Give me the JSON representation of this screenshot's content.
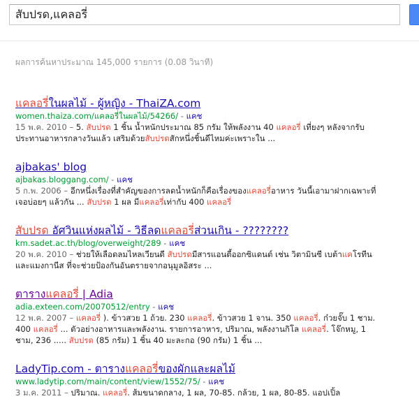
{
  "search": {
    "query": "สับปรด,แคลอรี่"
  },
  "stats": "ผลการค้นหาประมาณ 145,000 รายการ (0.08 วินาที)",
  "cache_label": "แคช",
  "results": [
    {
      "visited": false,
      "title": [
        {
          "t": "แคลอรี่",
          "hl": true
        },
        {
          "t": "ในผลไม้ - ผู้หญิง - ThaiZA.com",
          "hl": false
        }
      ],
      "url": [
        {
          "t": "women.thaiza.com/",
          "hl": false
        },
        {
          "t": "แคลอรี่",
          "hl": true
        },
        {
          "t": "ในผลไม้/54266/",
          "hl": false
        }
      ],
      "snippet": [
        {
          "t": "15 พ.ค. 2010 – ",
          "c": "date"
        },
        {
          "t": "5. ",
          "c": ""
        },
        {
          "t": "สับปรด",
          "c": "hl"
        },
        {
          "t": " 1 ชิ้น น้ำหนักประมาณ 85 กรัม ให้พลังงาน 40 ",
          "c": ""
        },
        {
          "t": "แคลอรี่",
          "c": "hl"
        },
        {
          "t": " เที่ยงๆ หลังจากรับประทานอาหารกลางวันแล้ว เสริมด้วย",
          "c": ""
        },
        {
          "t": "สับปรด",
          "c": "hl"
        },
        {
          "t": "สักหนึ่งชิ้นดีไหมค่ะเพราะใน ...",
          "c": ""
        }
      ]
    },
    {
      "visited": false,
      "title": [
        {
          "t": "ajbakas' blog",
          "hl": false
        }
      ],
      "url": [
        {
          "t": "ajbakas.bloggang.com/",
          "hl": false
        }
      ],
      "snippet": [
        {
          "t": "5 ก.พ. 2006 – ",
          "c": "date"
        },
        {
          "t": "อีกหนึ่งเรื่องที่สำคัญของการลดน้ำหนักก็คือเรื่องของ",
          "c": ""
        },
        {
          "t": "แคลอรี่",
          "c": "hl"
        },
        {
          "t": "อาหาร วันนี้เอามาฝากเฉพาะที่เจอบ่อยๆ แล้วกัน ... ",
          "c": ""
        },
        {
          "t": "สับปรด",
          "c": "hl"
        },
        {
          "t": " 1 ผล มี",
          "c": ""
        },
        {
          "t": "แคลอรี่",
          "c": "hl"
        },
        {
          "t": "เท่ากับ 400 ",
          "c": ""
        },
        {
          "t": "แคลอรี่",
          "c": "hl"
        }
      ]
    },
    {
      "visited": false,
      "title": [
        {
          "t": "สับปรด",
          "hl": true
        },
        {
          "t": " อัศวินแห่งผลไม้ - วิธีลด",
          "hl": false
        },
        {
          "t": "แคลอรี่",
          "hl": true
        },
        {
          "t": "ส่วนเกิน - ????????",
          "hl": false
        }
      ],
      "url": [
        {
          "t": "km.sadet.ac.th/blog/overweight/289",
          "hl": false
        }
      ],
      "snippet": [
        {
          "t": "20 พ.ค. 2010 – ",
          "c": "date"
        },
        {
          "t": "ช่วยให้เลือดลมไหลเวียนดี ",
          "c": ""
        },
        {
          "t": "สับปรด",
          "c": "hl"
        },
        {
          "t": "มีสารแอนตี้ออกซิแดนต์ เช่น วิตามินซี เบต้า",
          "c": ""
        },
        {
          "t": "แค",
          "c": "hl"
        },
        {
          "t": "โรทีน และแมงกานีส ที่จะช่วยป้องกันอันตรายจากอนุมูลอิสระ ...",
          "c": ""
        }
      ]
    },
    {
      "visited": true,
      "title": [
        {
          "t": "ตาราง",
          "hl": false
        },
        {
          "t": "แคลอรี่",
          "hl": true
        },
        {
          "t": " | Adia",
          "hl": false
        }
      ],
      "url": [
        {
          "t": "adia.exteen.com/20070512/entry",
          "hl": false
        }
      ],
      "snippet": [
        {
          "t": "12 พ.ค. 2007 – ",
          "c": "date"
        },
        {
          "t": "แคลอรี่",
          "c": "hl"
        },
        {
          "t": " ). ข้าวสวย 1 ถ้วย. 230 ",
          "c": ""
        },
        {
          "t": "แคลอรี่",
          "c": "hl"
        },
        {
          "t": ". ข้าวสวย 1 จาน. 350 ",
          "c": ""
        },
        {
          "t": "แคลอรี่",
          "c": "hl"
        },
        {
          "t": ". ก๋วยจั๊บ 1 ชาม. 400 ",
          "c": ""
        },
        {
          "t": "แคลอรี่",
          "c": "hl"
        },
        {
          "t": " ... ตัวอย่างอาหารและพลังงาน. รายการอาหาร, ปริมาณ, พลังงานกิโล ",
          "c": ""
        },
        {
          "t": "แคลอรี่",
          "c": "hl"
        },
        {
          "t": ". โจ๊กหมู, 1 ชาม, 236 ..... ",
          "c": ""
        },
        {
          "t": "สับปรด",
          "c": "hl"
        },
        {
          "t": " (85 กรัม) 1 ชิ้น 40 มะละกอ (90 กรัม) 1 ชิ้น ...",
          "c": ""
        }
      ]
    },
    {
      "visited": false,
      "title": [
        {
          "t": "LadyTip.com - ตาราง",
          "hl": false
        },
        {
          "t": "แคลอรี่",
          "hl": true
        },
        {
          "t": "ของผักและผลไม้",
          "hl": false
        }
      ],
      "url": [
        {
          "t": "www.ladytip.com/main/content/view/1552/75/",
          "hl": false
        }
      ],
      "snippet": [
        {
          "t": "3 ม.ค. 2011 – ",
          "c": "date"
        },
        {
          "t": "ปริมาณ. ",
          "c": ""
        },
        {
          "t": "แคลอรี่",
          "c": "hl"
        },
        {
          "t": ". ส้มขนาดกลาง, 1 ผล, 70-85. กล้วย, 1 ผล, 80-85. แอปเปิ้ล",
          "c": ""
        }
      ]
    }
  ]
}
